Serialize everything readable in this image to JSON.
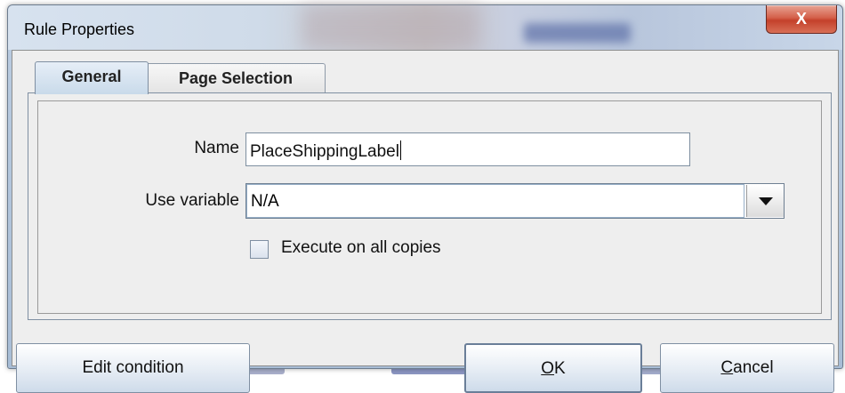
{
  "window": {
    "title": "Rule Properties",
    "close_label": "X"
  },
  "tabs": [
    {
      "label": "General",
      "active": true
    },
    {
      "label": "Page Selection",
      "active": false
    }
  ],
  "form": {
    "name_label": "Name",
    "name_value": "PlaceShippingLabel",
    "variable_label": "Use variable",
    "variable_value": "N/A",
    "checkbox_label": "Execute on all copies",
    "checkbox_checked": false
  },
  "buttons": {
    "edit_condition": "Edit condition",
    "ok_mnemonic": "O",
    "ok_rest": "K",
    "cancel_mnemonic": "C",
    "cancel_rest": "ancel"
  },
  "colors": {
    "close_button": "#c4412b",
    "tab_active": "#c9daea",
    "button_gradient_bottom": "#cedbea"
  }
}
